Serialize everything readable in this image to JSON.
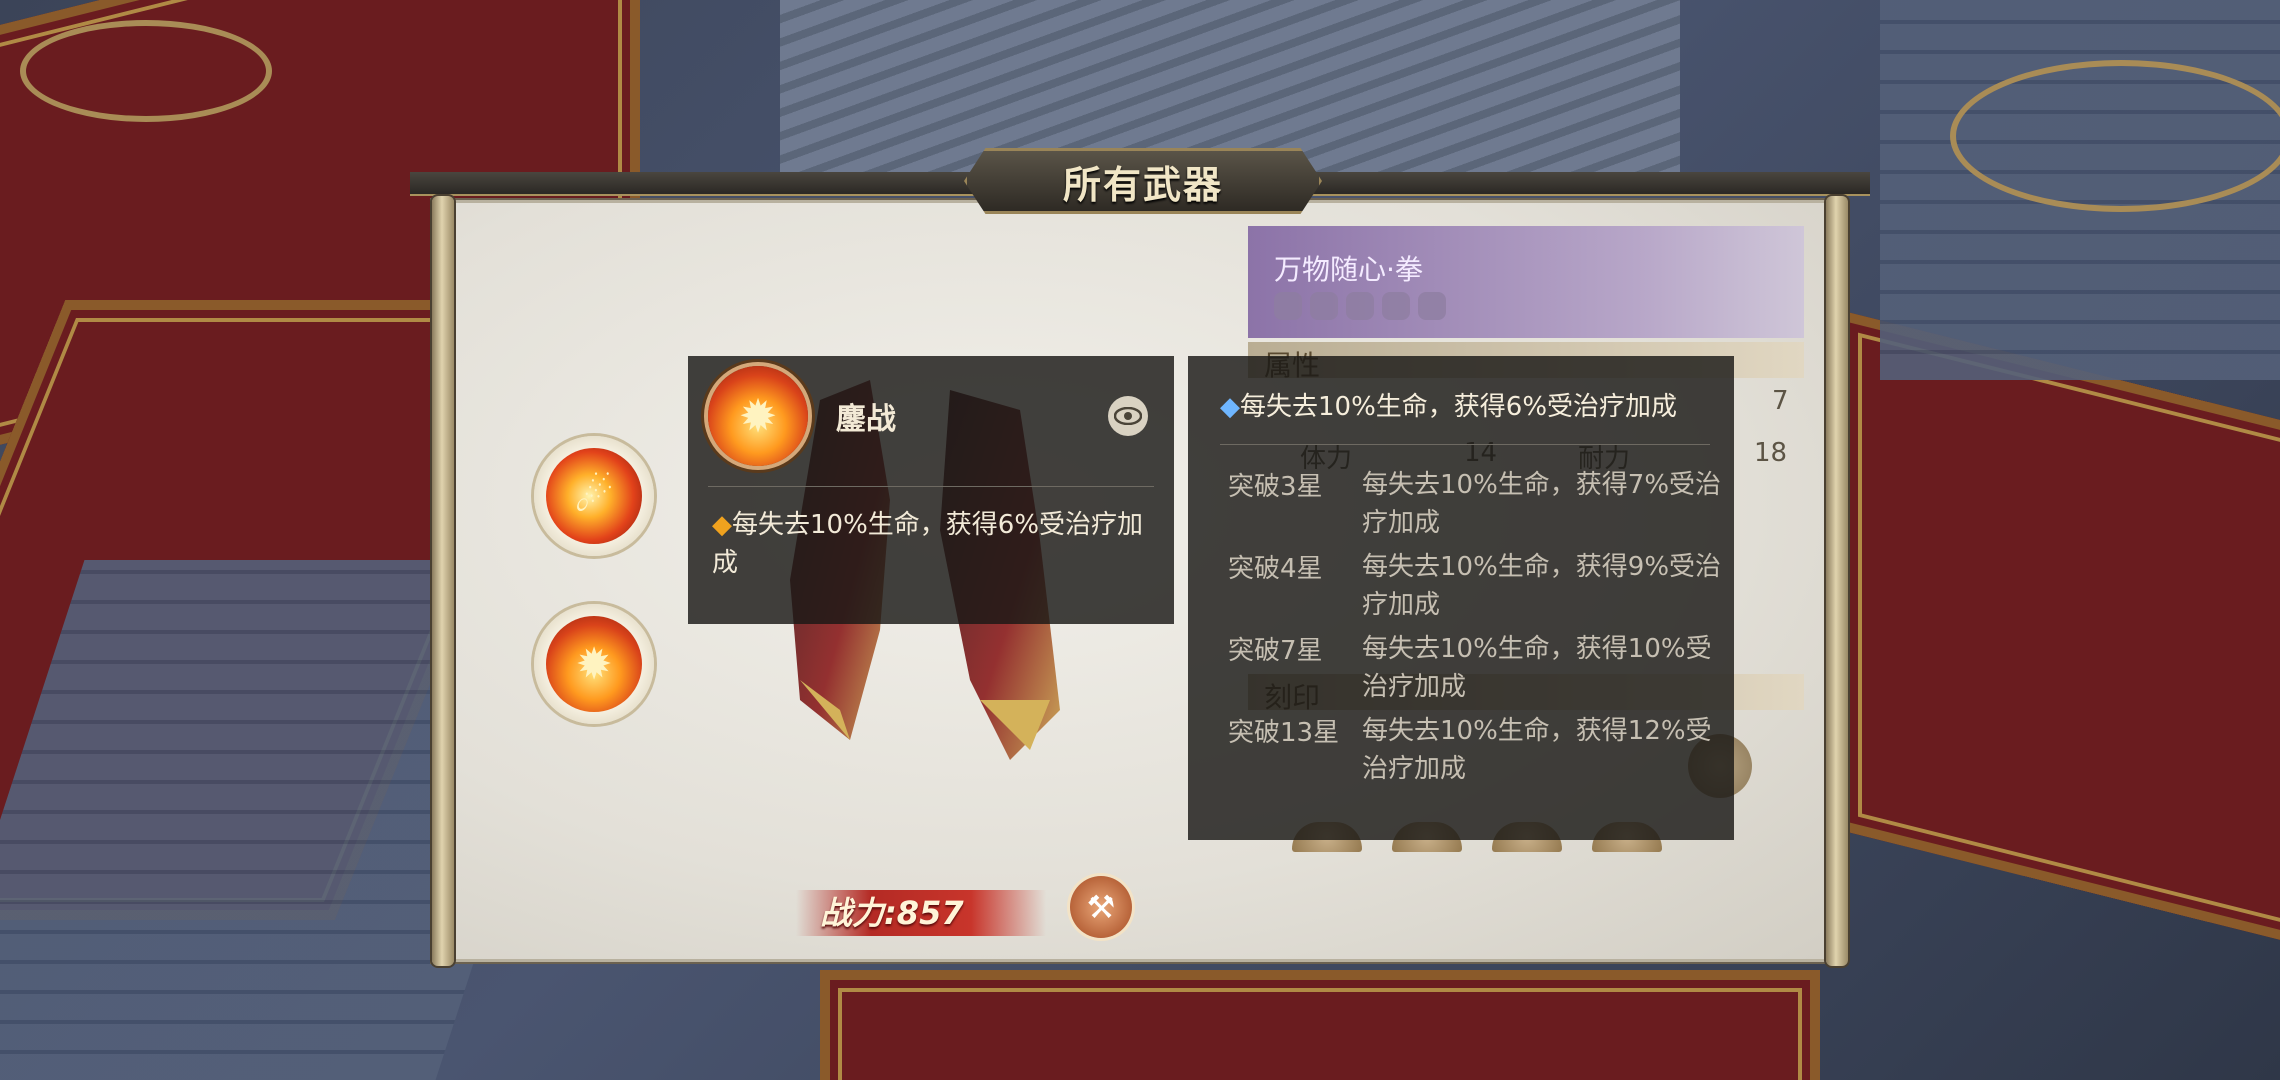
{
  "window": {
    "title": "所有武器"
  },
  "left_skills": [
    {
      "icon": "flame-swirl-icon"
    },
    {
      "icon": "fire-burst-icon"
    }
  ],
  "power": {
    "label": "战力:857"
  },
  "info_panel": {
    "weapon_name": "万物随心·拳",
    "section_attributes": "属性",
    "stats": [
      {
        "value": "7"
      },
      {
        "label": "体力",
        "value": "14"
      },
      {
        "label": "耐力",
        "value": "18"
      }
    ],
    "section_seal": "刻印"
  },
  "tooltip_skill": {
    "name": "鏖战",
    "bullet": "◆",
    "description": "每失去10%生命，获得6%受治疗加成"
  },
  "tooltip_breakthrough": {
    "bullet": "◆",
    "current": "每失去10%生命，获得6%受治疗加成",
    "rows": [
      {
        "label": "突破3星",
        "text": "每失去10%生命，获得7%受治疗加成"
      },
      {
        "label": "突破4星",
        "text": "每失去10%生命，获得9%受治疗加成"
      },
      {
        "label": "突破7星",
        "text": "每失去10%生命，获得10%受治疗加成"
      },
      {
        "label": "突破13星",
        "text": "每失去10%生命，获得12%受治疗加成"
      }
    ]
  }
}
